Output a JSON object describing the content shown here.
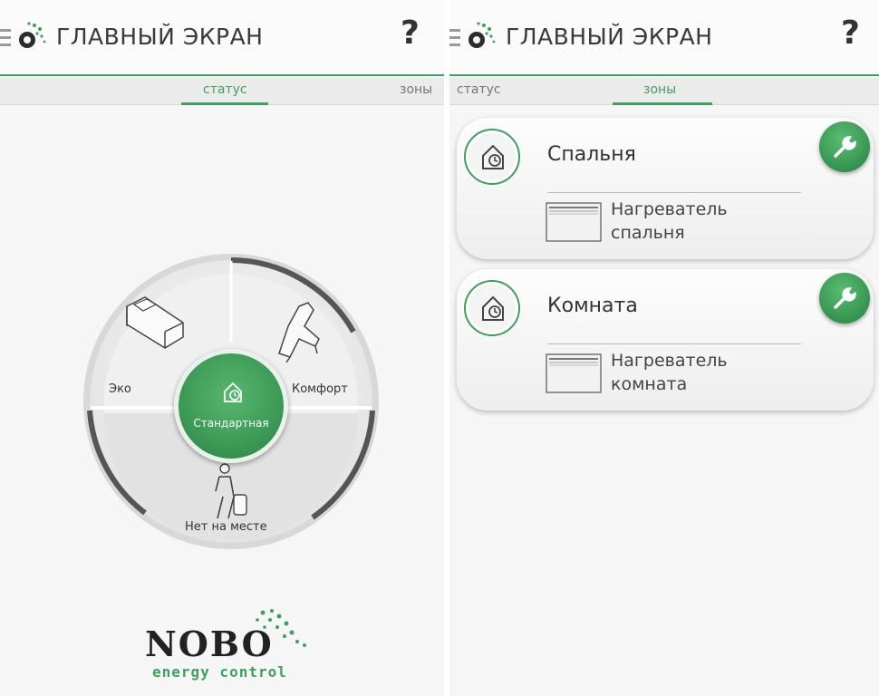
{
  "left_screen": {
    "header": {
      "title": "ГЛАВНЫЙ ЭКРАН",
      "help": "?"
    },
    "tabs": {
      "status": "статус",
      "zones": "зоны",
      "active": "status"
    },
    "modes": {
      "eco": "Эко",
      "comfort": "Комфорт",
      "away": "Нет на месте",
      "standard": "Стандартная",
      "selected": "standard"
    },
    "logo": {
      "word": "NOBO",
      "tagline": "energy control"
    }
  },
  "right_screen": {
    "header": {
      "title": "ГЛАВНЫЙ ЭКРАН",
      "help": "?"
    },
    "tabs": {
      "status": "статус",
      "zones": "зоны",
      "active": "zones"
    },
    "zones": [
      {
        "name": "Спальня",
        "heater_line1": "Нагреватель",
        "heater_line2": "спальня"
      },
      {
        "name": "Комната",
        "heater_line1": "Нагреватель",
        "heater_line2": "комната"
      }
    ]
  },
  "colors": {
    "accent": "#3f9f5e",
    "text": "#333333",
    "background": "#f6f6f6"
  },
  "icons": [
    "menu-icon",
    "nobo-app-icon",
    "help-icon",
    "bed-icon",
    "recliner-icon",
    "traveler-icon",
    "home-clock-icon",
    "heater-icon",
    "wrench-icon"
  ]
}
